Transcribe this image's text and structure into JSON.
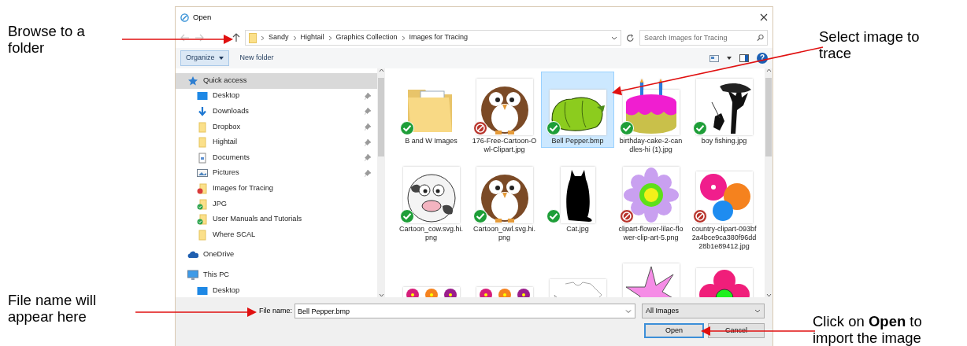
{
  "notes_left": [
    {
      "text": "Browse to a folder"
    },
    {
      "text": "File name will appear here"
    }
  ],
  "notes_right": [
    {
      "text": "Select image to trace"
    },
    {
      "text": "Click on **Open** to import the image"
    }
  ],
  "window": {
    "title": "Open"
  },
  "address": {
    "path": [
      "Sandy",
      "Hightail",
      "Graphics Collection",
      "Images for Tracing"
    ]
  },
  "search": {
    "placeholder": "Search Images for Tracing"
  },
  "toolbar": {
    "organize": "Organize",
    "new_folder": "New folder",
    "help": "?"
  },
  "nav": [
    {
      "label": "Quick access",
      "kind": "star",
      "selected": true,
      "children": [
        {
          "label": "Desktop",
          "kind": "desktop",
          "selected": false,
          "pinned": true
        },
        {
          "label": "Downloads",
          "kind": "download",
          "selected": false,
          "pinned": true
        },
        {
          "label": "Dropbox",
          "kind": "folder",
          "selected": false,
          "pinned": true
        },
        {
          "label": "Hightail",
          "kind": "folder",
          "selected": false,
          "pinned": true
        },
        {
          "label": "Documents",
          "kind": "document",
          "selected": false,
          "pinned": true
        },
        {
          "label": "Pictures",
          "kind": "pictures",
          "selected": false,
          "pinned": true
        },
        {
          "label": "Images for Tracing",
          "kind": "folder-error",
          "selected": false,
          "pinned": false
        },
        {
          "label": "JPG",
          "kind": "folder-synced",
          "selected": false,
          "pinned": false
        },
        {
          "label": "User Manuals and Tutorials",
          "kind": "folder-synced",
          "selected": false,
          "pinned": false
        },
        {
          "label": "Where SCAL",
          "kind": "folder",
          "selected": false,
          "pinned": false
        }
      ]
    },
    {
      "label": "OneDrive",
      "kind": "cloud",
      "selected": false
    },
    {
      "label": "This PC",
      "kind": "pc",
      "selected": false,
      "children": [
        {
          "label": "Desktop",
          "kind": "desktop",
          "selected": false,
          "pinned": false
        }
      ]
    }
  ],
  "files": [
    {
      "name": "B and W Images",
      "kind": "folder",
      "sync_error": false,
      "selected": false
    },
    {
      "name": "176-Free-Cartoon-Owl-Clipart.jpg",
      "kind": "owl",
      "sync_error": true,
      "selected": false
    },
    {
      "name": "Bell Pepper.bmp",
      "kind": "pepper",
      "sync_error": false,
      "selected": true
    },
    {
      "name": "birthday-cake-2-candles-hi (1).jpg",
      "kind": "cake",
      "sync_error": false,
      "selected": false
    },
    {
      "name": "boy fishing.jpg",
      "kind": "tree",
      "sync_error": false,
      "selected": false
    },
    {
      "name": "Cartoon_cow.svg.hi.png",
      "kind": "cow",
      "sync_error": false,
      "selected": false
    },
    {
      "name": "Cartoon_owl.svg.hi.png",
      "kind": "owl",
      "sync_error": false,
      "selected": false
    },
    {
      "name": "Cat.jpg",
      "kind": "cat",
      "sync_error": false,
      "selected": false
    },
    {
      "name": "clipart-flower-lilac-flower-clip-art-5.png",
      "kind": "flower",
      "sync_error": true,
      "selected": false
    },
    {
      "name": "country-clipart-093bf2a4bce9ca380f96dd28b1e89412.jpg",
      "kind": "hibiscus",
      "sync_error": true,
      "selected": false
    },
    {
      "kind": "flowers",
      "selected": false
    },
    {
      "kind": "flowers",
      "selected": false
    },
    {
      "kind": "shirt",
      "selected": false
    },
    {
      "kind": "star",
      "selected": false
    },
    {
      "kind": "pink-flower",
      "selected": false
    }
  ],
  "footer": {
    "file_name_label": "File name:",
    "file_name": "Bell Pepper.bmp",
    "filter": "All Images",
    "open": "Open",
    "cancel": "Cancel"
  }
}
